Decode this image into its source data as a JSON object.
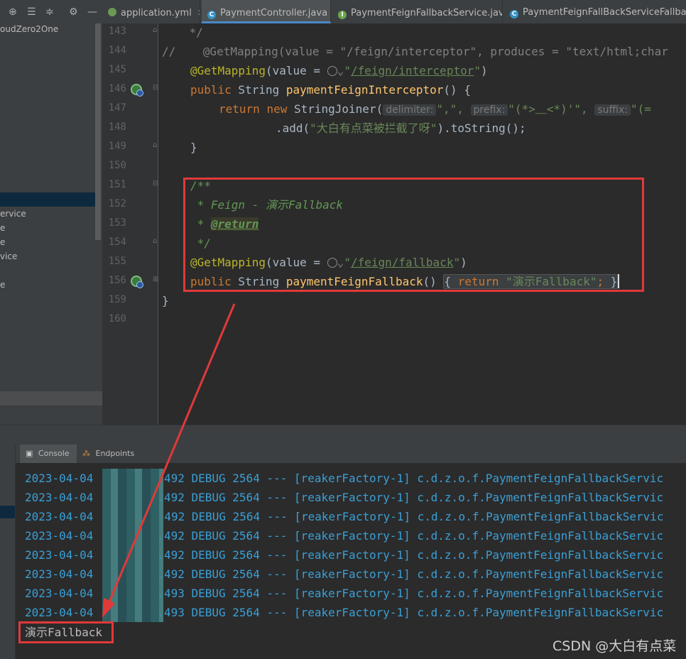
{
  "tabs": [
    {
      "label": "application.yml",
      "icon": "yaml-file-icon",
      "color": "#6a9955",
      "active": false
    },
    {
      "label": "PaymentController.java",
      "icon": "class-file-icon",
      "color": "#3592c4",
      "active": true
    },
    {
      "label": "PaymentFeignFallbackService.java",
      "icon": "interface-file-icon",
      "color": "#6aa84f",
      "active": false
    },
    {
      "label": "PaymentFeignFallBackServiceFallbackFa",
      "icon": "class-file-icon",
      "color": "#3592c4",
      "active": false
    }
  ],
  "toolbar_icons": [
    "crosshair-icon",
    "expand-icon",
    "collapse-icon",
    "gear-icon",
    "minimize-icon"
  ],
  "project_panel": {
    "items": [
      "oudZero2One",
      "ervice",
      "e",
      "e",
      "vice",
      "e"
    ]
  },
  "editor": {
    "line_numbers": [
      "143",
      "144",
      "145",
      "146",
      "147",
      "148",
      "149",
      "150",
      "151",
      "152",
      "153",
      "154",
      "155",
      "156",
      "159",
      "160"
    ],
    "lines": {
      "l143": "    */",
      "l144": "//    @GetMapping(value = \"/feign/interceptor\", produces = \"text/html;char",
      "l145_annot": "@GetMapping",
      "l145_value": "(value = ",
      "l145_url": "/feign/interceptor",
      "l146_public": "public",
      "l146_type": " String ",
      "l146_fn": "paymentFeignInterceptor",
      "l146_rest": "() {",
      "l147_return": "return",
      "l147_new": "new",
      "l147_cls": " StringJoiner(",
      "l147_hint1": "delimiter:",
      "l147_str1": "\",\",",
      "l147_hint2": "prefix:",
      "l147_str2": "\"(*>﹏<*)'\",",
      "l147_hint3": "suffix:",
      "l147_str3": "\"(=",
      "l148_pre": ".add(",
      "l148_str": "\"大白有点菜被拦截了呀\"",
      "l148_post": ").toString();",
      "l149": "}",
      "l151": "/**",
      "l152": " * Feign - 演示Fallback",
      "l153_pre": " * ",
      "l153_tag": "@return",
      "l154": " */",
      "l155_annot": "@GetMapping",
      "l155_value": "(value = ",
      "l155_url": "/feign/fallback",
      "l156_public": "public",
      "l156_type": " String ",
      "l156_fn": "paymentFeignFallback",
      "l156_paren": "()",
      "l156_open": "{",
      "l156_return": "return",
      "l156_str": "\"演示Fallback\"",
      "l156_semi": ";",
      "l156_close": "}",
      "l159": "}"
    }
  },
  "bottom_tabs": [
    {
      "label": "Console",
      "icon": "console-icon"
    },
    {
      "label": "Endpoints",
      "icon": "endpoints-icon"
    }
  ],
  "console": {
    "log_lines": [
      {
        "date": "2023-04-04",
        "ms": ".492",
        "rest": " DEBUG 2564 --- [reakerFactory-1] c.d.z.o.f.PaymentFeignFallbackServic"
      },
      {
        "date": "2023-04-04",
        "ms": ".492",
        "rest": " DEBUG 2564 --- [reakerFactory-1] c.d.z.o.f.PaymentFeignFallbackServic"
      },
      {
        "date": "2023-04-04",
        "ms": "492",
        "rest": " DEBUG 2564 --- [reakerFactory-1] c.d.z.o.f.PaymentFeignFallbackServic"
      },
      {
        "date": "2023-04-04",
        "ms": ".492",
        "rest": " DEBUG 2564 --- [reakerFactory-1] c.d.z.o.f.PaymentFeignFallbackServic"
      },
      {
        "date": "2023-04-04",
        "ms": ".492",
        "rest": " DEBUG 2564 --- [reakerFactory-1] c.d.z.o.f.PaymentFeignFallbackServic"
      },
      {
        "date": "2023-04-04",
        "ms": ".492",
        "rest": " DEBUG 2564 --- [reakerFactory-1] c.d.z.o.f.PaymentFeignFallbackServic"
      },
      {
        "date": "2023-04-04",
        "ms": ".493",
        "rest": " DEBUG 2564 --- [reakerFactory-1] c.d.z.o.f.PaymentFeignFallbackServic"
      },
      {
        "date": "2023-04-04",
        "ms": ".493",
        "rest": " DEBUG 2564 --- [reakerFactory-1] c.d.z.o.f.PaymentFeignFallbackServic"
      }
    ],
    "output": "演示Fallback"
  },
  "watermark": "CSDN @大白有点菜",
  "colors": {
    "highlight_red": "#e0393a",
    "log_blue": "#3a9fd6"
  }
}
